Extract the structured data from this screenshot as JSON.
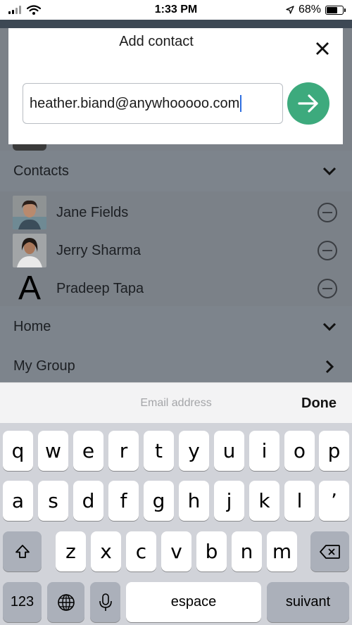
{
  "status_bar": {
    "time": "1:33 PM",
    "battery_percent": "68%",
    "battery_level": 0.68
  },
  "background": {
    "sections": [
      {
        "label": "Contacts"
      },
      {
        "label": "Home"
      },
      {
        "label": "My Group"
      }
    ],
    "contacts": [
      {
        "name": "Jane Fields"
      },
      {
        "name": "Jerry Sharma"
      },
      {
        "name": "Pradeep Tapa",
        "avatar_letter": "A"
      }
    ]
  },
  "modal": {
    "title": "Add contact",
    "email_value": "heather.biand@anywhooooo.com"
  },
  "keyboard": {
    "accessory_placeholder": "Email address",
    "done_label": "Done",
    "row1": [
      "q",
      "w",
      "e",
      "r",
      "t",
      "y",
      "u",
      "i",
      "o",
      "p"
    ],
    "row2": [
      "a",
      "s",
      "d",
      "f",
      "g",
      "h",
      "j",
      "k",
      "l",
      "’"
    ],
    "row3": [
      "z",
      "x",
      "c",
      "v",
      "b",
      "n",
      "m"
    ],
    "numbers_label": "123",
    "space_label": "espace",
    "return_label": "suivant"
  },
  "colors": {
    "accent_green": "#3daa7d",
    "caret_blue": "#2f6fe0"
  }
}
